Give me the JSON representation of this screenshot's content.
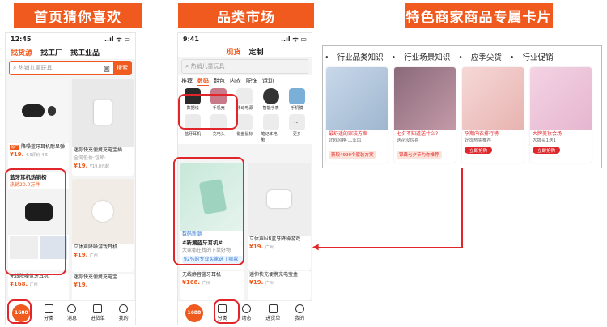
{
  "banners": [
    "首页猜你喜欢",
    "品类市场",
    "特色商家商品专属卡片"
  ],
  "phone1": {
    "time": "12:45",
    "signal": "..ıl ᯤ ▭",
    "tabs": [
      "找货源",
      "找工厂",
      "找工业品"
    ],
    "search_placeholder": "热销儿童玩具",
    "search_button": "搜索",
    "cards": [
      {
        "badge": "源厂",
        "title": "降噪蓝牙耳机耐显弹",
        "price": "¥19.",
        "sub": "4.9评价 4.5"
      },
      {
        "title": "迷你快充便携充电宝插",
        "tags": "全网低价·包邮·",
        "price": "¥19.",
        "sub": "¥19.8元起"
      },
      {
        "title": "蓝牙耳机热销榜",
        "subtitle": "热销20.0万件"
      },
      {
        "title": "立体声降噪游戏耳机",
        "price": "¥19.",
        "sub": "广州"
      },
      {
        "title": "迷你快充便携充电宝",
        "price": "¥19.",
        "sub": ""
      },
      {
        "title": "无线降噪蓝牙耳机",
        "price": "¥168.",
        "sub": "广州"
      }
    ],
    "bottom_nav": [
      "1688",
      "分类",
      "消息",
      "进货单",
      "我的"
    ]
  },
  "phone2": {
    "time": "9:41",
    "signal": "..ıl ᯤ ▭",
    "top_tabs": [
      "现货",
      "定制"
    ],
    "search_placeholder": "热销儿童玩具",
    "cat_tabs": [
      "推荐",
      "数码",
      "鞋包",
      "内衣",
      "配饰",
      "运动"
    ],
    "icons": [
      {
        "label": "数据线"
      },
      {
        "label": "手机壳"
      },
      {
        "label": "移动电源"
      },
      {
        "label": "智能手表"
      },
      {
        "label": "手机膜"
      }
    ],
    "icons2": [
      {
        "label": "蓝牙耳机"
      },
      {
        "label": "充电头"
      },
      {
        "label": "键盘鼠标"
      },
      {
        "label": "笔记本电脑"
      },
      {
        "label": "更多"
      }
    ],
    "feature_card": {
      "tag": "数码新潮",
      "title": "#新潮蓝牙耳机#",
      "desc": "大家都在找的下单好物",
      "cta": "92%的专业买家选了哪款"
    },
    "cards": [
      {
        "title": "立体声hifi蓝牙降噪游戏",
        "price": "¥19.",
        "sub": "广州"
      },
      {
        "title": "迷你快充便携充电宝盒",
        "price": "¥19.",
        "sub": "广州"
      },
      {
        "title": "无线静音蓝牙耳机",
        "price": "¥168.",
        "sub": "广州"
      },
      {
        "title": "迷你快充便携充电宝盒",
        "price": "¥19.",
        "sub": "广州"
      }
    ],
    "bottom_nav": [
      "1688",
      "分类",
      "动态",
      "进货单",
      "我的"
    ]
  },
  "feature": {
    "labels": [
      "行业品类知识",
      "行业场景知识",
      "应季尖货",
      "行业促销"
    ],
    "cards": [
      {
        "title": "最舒适的家装方案",
        "sub": "北欧风格·工业风",
        "pill": "获取4999个家装方案"
      },
      {
        "title": "七夕不知道送什么?",
        "sub": "送花没惊喜",
        "pill": "锦囊七夕节为你推荐"
      },
      {
        "title": "孕期内衣排行榜",
        "sub": "好货热卖推荐",
        "btn": "立即抢购"
      },
      {
        "title": "大牌美妆会场",
        "sub": "大牌买1送1",
        "btn": "立即抢购"
      }
    ]
  },
  "colors": {
    "brand": "#f05a1e",
    "highlight": "#e0262a"
  }
}
